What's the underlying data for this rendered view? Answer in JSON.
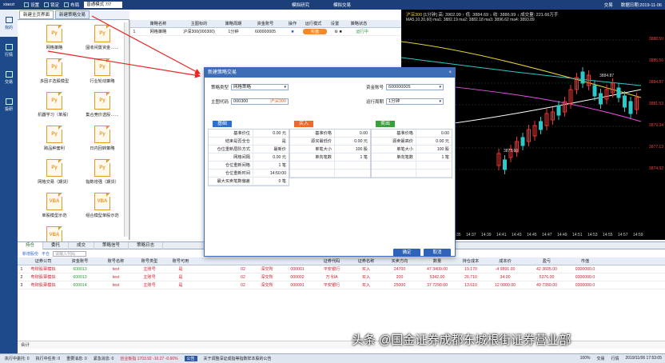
{
  "topbar": {
    "brand": "xiaozi",
    "buttons": [
      "设置",
      "锁定",
      "布局"
    ],
    "mode": "普通模式 7/7",
    "mid": [
      "模拟研究",
      "模拟交易"
    ],
    "right": [
      "交易",
      "数据日期:2019-11-06"
    ]
  },
  "sidebar": [
    {
      "label": "我的",
      "icon": "home-icon"
    },
    {
      "label": "行情",
      "icon": "chart-icon"
    },
    {
      "label": "交易",
      "icon": "trade-icon"
    },
    {
      "label": "投研",
      "icon": "research-icon"
    }
  ],
  "left_tabs": [
    "新建主页界面",
    "新建策略交易"
  ],
  "strategies": [
    {
      "label": "网格策略",
      "type": "Py"
    },
    {
      "label": "固收闲置资金……",
      "type": "Py"
    },
    {
      "label": "多因子选股模型",
      "type": "Py"
    },
    {
      "label": "行业轮动策略",
      "type": "Py"
    },
    {
      "label": "机器学习（单股）",
      "type": "Py"
    },
    {
      "label": "集合竞价选股……",
      "type": "Py"
    },
    {
      "label": "跨品种套利",
      "type": "Py"
    },
    {
      "label": "日内回转策略",
      "type": "Py"
    },
    {
      "label": "网格交易（期货）",
      "type": "Py"
    },
    {
      "label": "指数增强（期货）",
      "type": "Py"
    },
    {
      "label": "单股模型示范",
      "type": "VBA"
    },
    {
      "label": "组合模型单股示范",
      "type": "VBA"
    },
    {
      "label": "",
      "type": "VBA"
    }
  ],
  "strat_table": {
    "headers": [
      "",
      "策略名称",
      "主图标的",
      "策略周期",
      "资金账号",
      "操作",
      "运行模式",
      "设置",
      "策略状态"
    ],
    "rows": [
      [
        "1",
        "网格策略",
        "沪深300(000300)",
        "1分钟",
        "600000005",
        "■",
        "实盘",
        "⚙ ■",
        "运行中"
      ]
    ]
  },
  "chart": {
    "title": "沪深300",
    "period": "1分钟",
    "hdr": "高: 3902.99 ↑  低: 3884.69 ↓  收: 3886.99 ↓  成交量: 221.66万手",
    "ma": "MA5,10,20,60)  ma1: 3882.19  ma2: 3882.18  ma3: 3896.62  ma4: 3893.89",
    "yticks": [
      "3888.50",
      "3885.56",
      "3884.87",
      "3881.53",
      "3879.34",
      "3877.13",
      "3874.92"
    ],
    "xticks": [
      "14:35",
      "14:37",
      "14:39",
      "14:41",
      "14:43",
      "14:45",
      "14:47",
      "14:49",
      "14:51",
      "14:53",
      "14:55",
      "14:57",
      "14:59"
    ],
    "hi_label": "3884.87",
    "lo_label": "3873.60",
    "colors": {
      "up": "#e33",
      "down": "#2dc9c9"
    }
  },
  "dialog": {
    "title": "新建策略交易",
    "close": "×",
    "strategy_type_label": "策略类型",
    "strategy_type": "网格策略",
    "account_label": "资金账号",
    "account": "600000005",
    "symbol_label": "主图代码",
    "symbol_code": "000300",
    "symbol_name": "沪深300",
    "period_label": "运行周期",
    "period": "1分钟",
    "base": {
      "title": "基础",
      "rows": [
        [
          "基准价位",
          "0.00 元"
        ],
        [
          "结束是否全仓",
          "是"
        ],
        [
          "仓位重新层阶方式",
          "最新价"
        ],
        [
          "网格间隔",
          "0.00 元"
        ],
        [
          "仓位重新间格",
          "1 笔"
        ],
        [
          "仓位重新时间",
          "14:50:00"
        ],
        [
          "最大买卖笔数偏差",
          "0 笔"
        ]
      ]
    },
    "buy": {
      "title": "买入",
      "rows": [
        [
          "基准价格",
          "0.00"
        ],
        [
          "源买最低价",
          "0.00 元"
        ],
        [
          "单笔大小",
          "100 股"
        ],
        [
          "单向笔数",
          "1 笔"
        ],
        [
          "",
          ""
        ],
        [
          "",
          ""
        ]
      ]
    },
    "sell": {
      "title": "卖出",
      "rows": [
        [
          "基准价格",
          "0.00"
        ],
        [
          "源卖最高价",
          "0.00 元"
        ],
        [
          "单笔大小",
          "100 股"
        ],
        [
          "单向笔数",
          "1 笔"
        ],
        [
          "",
          ""
        ],
        [
          "",
          ""
        ]
      ]
    },
    "ok": "确定",
    "cancel": "取消",
    "colors": {
      "base": "#2f6fd0",
      "buy": "#f0682a",
      "sell": "#38a038"
    }
  },
  "bottom_tabs": [
    "持仓",
    "委托",
    "成交",
    "策略信号",
    "策略日志"
  ],
  "bottom_toolbar": {
    "b1": "新增股份",
    "b2": "平仓",
    "placeholder": "请输入代码"
  },
  "bottom_table": {
    "headers": [
      "",
      "证券公司",
      "资金账号",
      "账号名称",
      "账号类型",
      "账号可用",
      "",
      "",
      "",
      "",
      "",
      "证券代码",
      "证券名称",
      "买卖方向",
      "数量",
      "持仓成本",
      "成本价",
      "盈亏",
      "市值",
      "股东账号"
    ],
    "rows": [
      [
        "1",
        "粤财股票模拟",
        "600013",
        "test",
        "主账号",
        "是",
        "",
        "",
        "02",
        "深交所",
        "000001",
        "平安银行",
        "买入",
        "24700",
        "47 3400.00",
        "19.170",
        "-4 9891.00",
        "42 3605.00",
        "0300000.0"
      ],
      [
        "2",
        "粤财股票模拟",
        "600013",
        "test",
        "主账号",
        "是",
        "",
        "",
        "02",
        "深交所",
        "000002",
        "万 科A",
        "买入",
        "200",
        "5342.00",
        "26.710",
        "34.00",
        "5376.00",
        "0300000.0"
      ],
      [
        "3",
        "粤财股票模拟",
        "600014",
        "test",
        "主账号",
        "是",
        "",
        "",
        "02",
        "深交所",
        "000001",
        "平安银行",
        "买入",
        "25000",
        "37 7290.00",
        "13.610",
        "12 0000.00",
        "49 7350.00",
        "0300000.0"
      ]
    ]
  },
  "sum_label": "合计",
  "status": {
    "items": [
      "执行中委托: 0",
      "执行中任务: 0",
      "重要消息: 0",
      "紧急消息: 0"
    ],
    "index": "创业板指  1703.92  -10.27  -0.60%",
    "notice": "公告",
    "notice_text": "关于调整深证成指等指数样本股的公告",
    "right": [
      "100%",
      "交易",
      "行情",
      "2019/11/06 17:53:05"
    ]
  },
  "watermark": "头条 @国金证券成都东城根街证券营业部"
}
